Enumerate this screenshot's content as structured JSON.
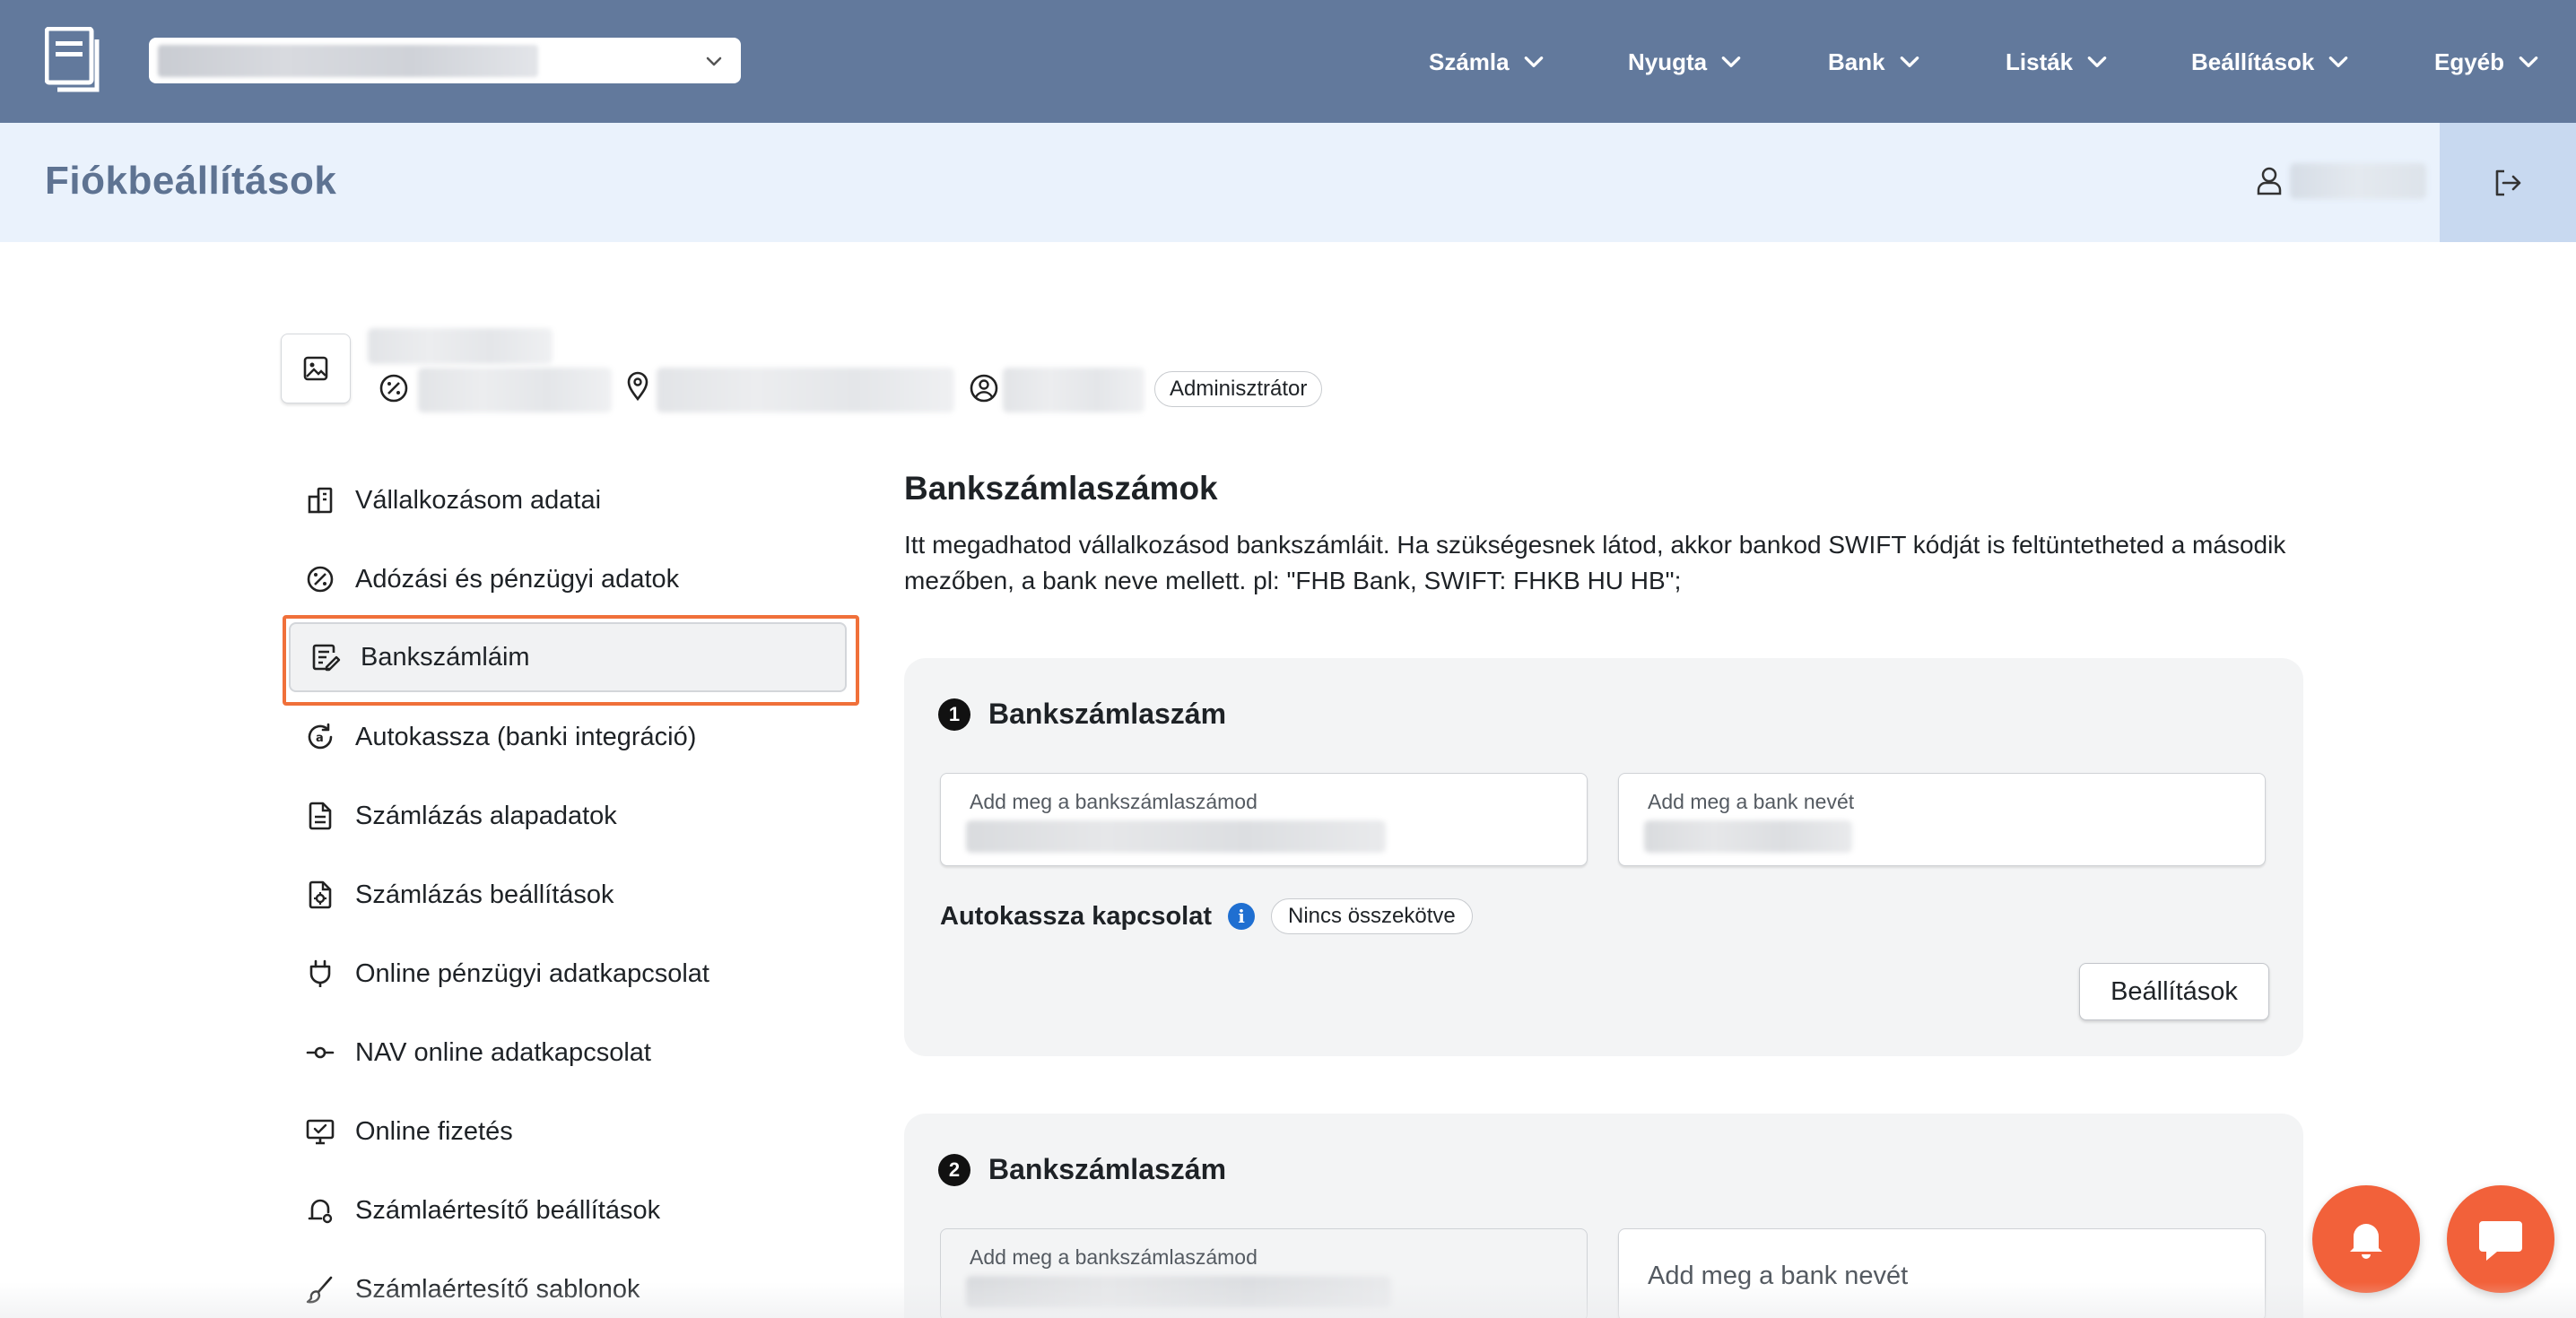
{
  "header": {
    "nav": [
      {
        "label": "Számla"
      },
      {
        "label": "Nyugta"
      },
      {
        "label": "Bank"
      },
      {
        "label": "Listák"
      },
      {
        "label": "Beállítások"
      },
      {
        "label": "Egyéb"
      }
    ]
  },
  "page": {
    "title": "Fiókbeállítások"
  },
  "account": {
    "role": "Adminisztrátor"
  },
  "sidebar": {
    "active_index": 2,
    "items": [
      {
        "label": "Vállalkozásom adatai",
        "icon": "building-icon"
      },
      {
        "label": "Adózási és pénzügyi adatok",
        "icon": "percent-icon"
      },
      {
        "label": "Bankszámláim",
        "icon": "document-edit-icon"
      },
      {
        "label": "Autokassza (banki integráció)",
        "icon": "auto-refresh-icon"
      },
      {
        "label": "Számlázás alapadatok",
        "icon": "document-icon"
      },
      {
        "label": "Számlázás beállítások",
        "icon": "document-settings-icon"
      },
      {
        "label": "Online pénzügyi adatkapcsolat",
        "icon": "plug-icon"
      },
      {
        "label": "NAV online adatkapcsolat",
        "icon": "connection-icon"
      },
      {
        "label": "Online fizetés",
        "icon": "monitor-icon"
      },
      {
        "label": "Számlaértesítő beállítások",
        "icon": "notification-settings-icon"
      },
      {
        "label": "Számlaértesítő sablonok",
        "icon": "brush-icon"
      }
    ]
  },
  "main": {
    "title": "Bankszámlaszámok",
    "description": "Itt megadhatod vállalkozásod bankszámláit. Ha szükségesnek látod, akkor bankod SWIFT kódját is feltüntetheted a második mezőben, a bank neve mellett. pl: \"FHB Bank, SWIFT: FHKB HU HB\";",
    "accounts": [
      {
        "number": "1",
        "title": "Bankszámlaszám",
        "account_label": "Add meg a bankszámlaszámod",
        "bank_label": "Add meg a bank nevét",
        "autokassza_label": "Autokassza kapcsolat",
        "status": "Nincs összekötve",
        "settings_button": "Beállítások"
      },
      {
        "number": "2",
        "title": "Bankszámlaszám",
        "account_label": "Add meg a bankszámlaszámod",
        "bank_placeholder": "Add meg a bank nevét"
      }
    ]
  },
  "colors": {
    "topbar": "#62799c",
    "page_header": "#eaf2fc",
    "title_text": "#5e7392",
    "focus_ring": "#f0703a",
    "fab": "#f2613a",
    "info": "#1f6fd1"
  }
}
